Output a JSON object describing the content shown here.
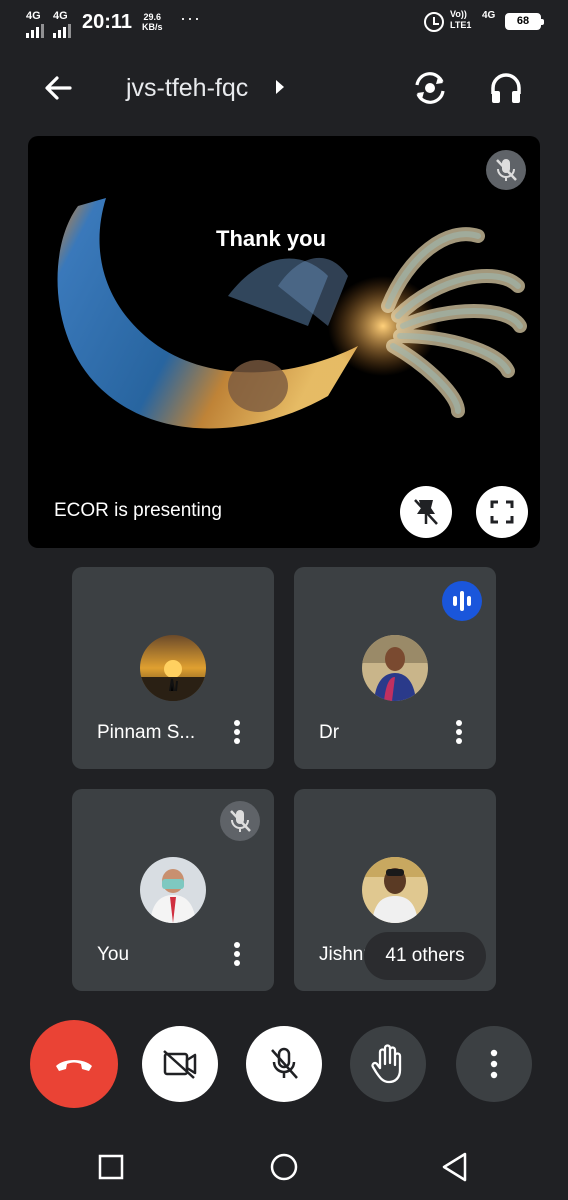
{
  "status_bar": {
    "network_1": "4G",
    "network_2": "4G",
    "time": "20:11",
    "speed_value": "29.6",
    "speed_unit": "KB/s",
    "more": "···",
    "volte": "Vo))",
    "lte": "LTE1",
    "network_3": "4G",
    "battery": "68"
  },
  "header": {
    "meeting_code": "jvs-tfeh-fqc",
    "icons": [
      "back-arrow-icon",
      "switch-camera-icon",
      "headphones-icon"
    ]
  },
  "presentation": {
    "slide_text": "Thank you",
    "presenter_label": "ECOR is presenting"
  },
  "participants": [
    {
      "name": "Pinnam S...",
      "muted": false,
      "speaking": false
    },
    {
      "name": "Dr",
      "muted": false,
      "speaking": true
    },
    {
      "name": "You",
      "muted": true,
      "speaking": false
    },
    {
      "name": "Jishnu",
      "muted": false,
      "speaking": false
    }
  ],
  "others_label": "41 others",
  "controls": [
    "end-call-icon",
    "camera-off-icon",
    "mic-off-icon",
    "raise-hand-icon",
    "more-options-icon"
  ],
  "colors": {
    "background": "#202124",
    "tile": "#3c4043",
    "end_call": "#ea4335",
    "speaking": "#1a56db"
  }
}
